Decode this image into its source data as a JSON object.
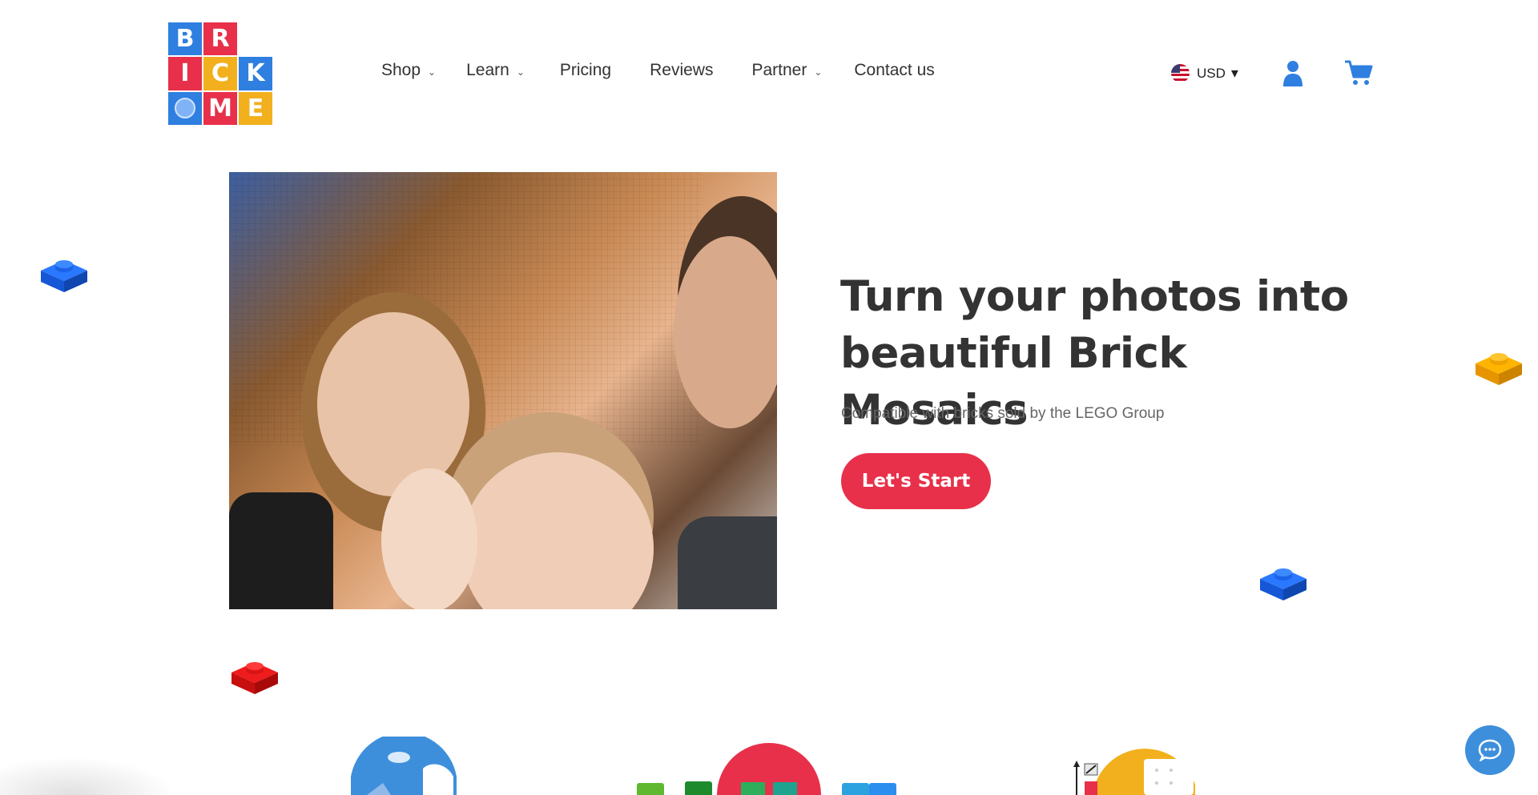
{
  "logo": {
    "letters": [
      "B",
      "R",
      "",
      "I",
      "C",
      "K",
      "",
      "M",
      "E"
    ],
    "colors": [
      "#2f7fe0",
      "#e8304a",
      "",
      "#e8304a",
      "#f2b01e",
      "#2f7fe0",
      "#2f7fe0",
      "#e8304a",
      "#f2b01e"
    ]
  },
  "nav": {
    "items": [
      {
        "label": "Shop",
        "dropdown": true
      },
      {
        "label": "Learn",
        "dropdown": true
      },
      {
        "label": "Pricing",
        "dropdown": false
      },
      {
        "label": "Reviews",
        "dropdown": false
      },
      {
        "label": "Partner",
        "dropdown": true
      },
      {
        "label": "Contact us",
        "dropdown": false
      }
    ]
  },
  "header": {
    "currency": "USD",
    "currency_caret": "▾",
    "flag_icon": "us-flag-icon",
    "account_icon": "user-icon",
    "cart_icon": "cart-icon"
  },
  "hero": {
    "title": "Turn your photos into beautiful Brick Mosaics",
    "subtitle": "Compatible with bricks sold by the LEGO Group",
    "cta_label": "Let's Start"
  },
  "colors": {
    "brand_red": "#e8304a",
    "brand_blue": "#2f7fe0",
    "brand_yellow": "#f2b01e",
    "text_dark": "#333333",
    "chat_blue": "#3d8fdc"
  }
}
